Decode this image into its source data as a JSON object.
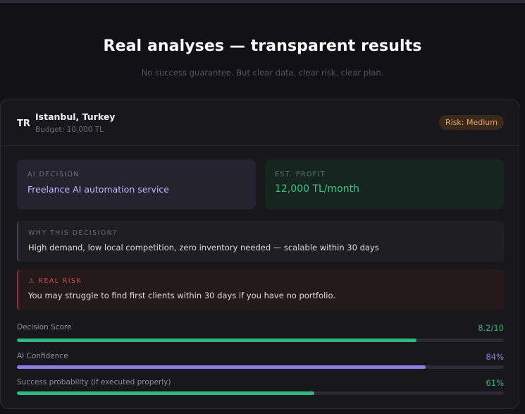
{
  "section": {
    "title": "Real analyses — transparent results",
    "subtitle": "No success guarantee. But clear data, clear risk, clear plan."
  },
  "card": {
    "country_code": "TR",
    "location": "Istanbul, Turkey",
    "budget": "Budget: 10,000 TL",
    "risk_badge": "Risk: Medium",
    "risk_badge_color": "#f0a35a",
    "ai_decision": {
      "label": "AI DECISION",
      "value": "Freelance AI automation service"
    },
    "est_profit": {
      "label": "EST. PROFIT",
      "value": "12,000 TL/month"
    },
    "why": {
      "label": "WHY THIS DECISION?",
      "text": "High demand, low local competition, zero inventory needed — scalable within 30 days"
    },
    "real_risk": {
      "icon": "warning-icon",
      "label": "REAL RISK",
      "text": "You may struggle to find first clients within 30 days if you have no portfolio."
    },
    "metrics": [
      {
        "label": "Decision Score",
        "value": "8.2/10",
        "fraction": 0.82,
        "color": "#2fb87e"
      },
      {
        "label": "AI Confidence",
        "value": "84%",
        "fraction": 0.84,
        "color": "#8a7ee6"
      },
      {
        "label": "Success probability (if executed properly)",
        "value": "61%",
        "fraction": 0.61,
        "color": "#2fb87e"
      }
    ]
  }
}
